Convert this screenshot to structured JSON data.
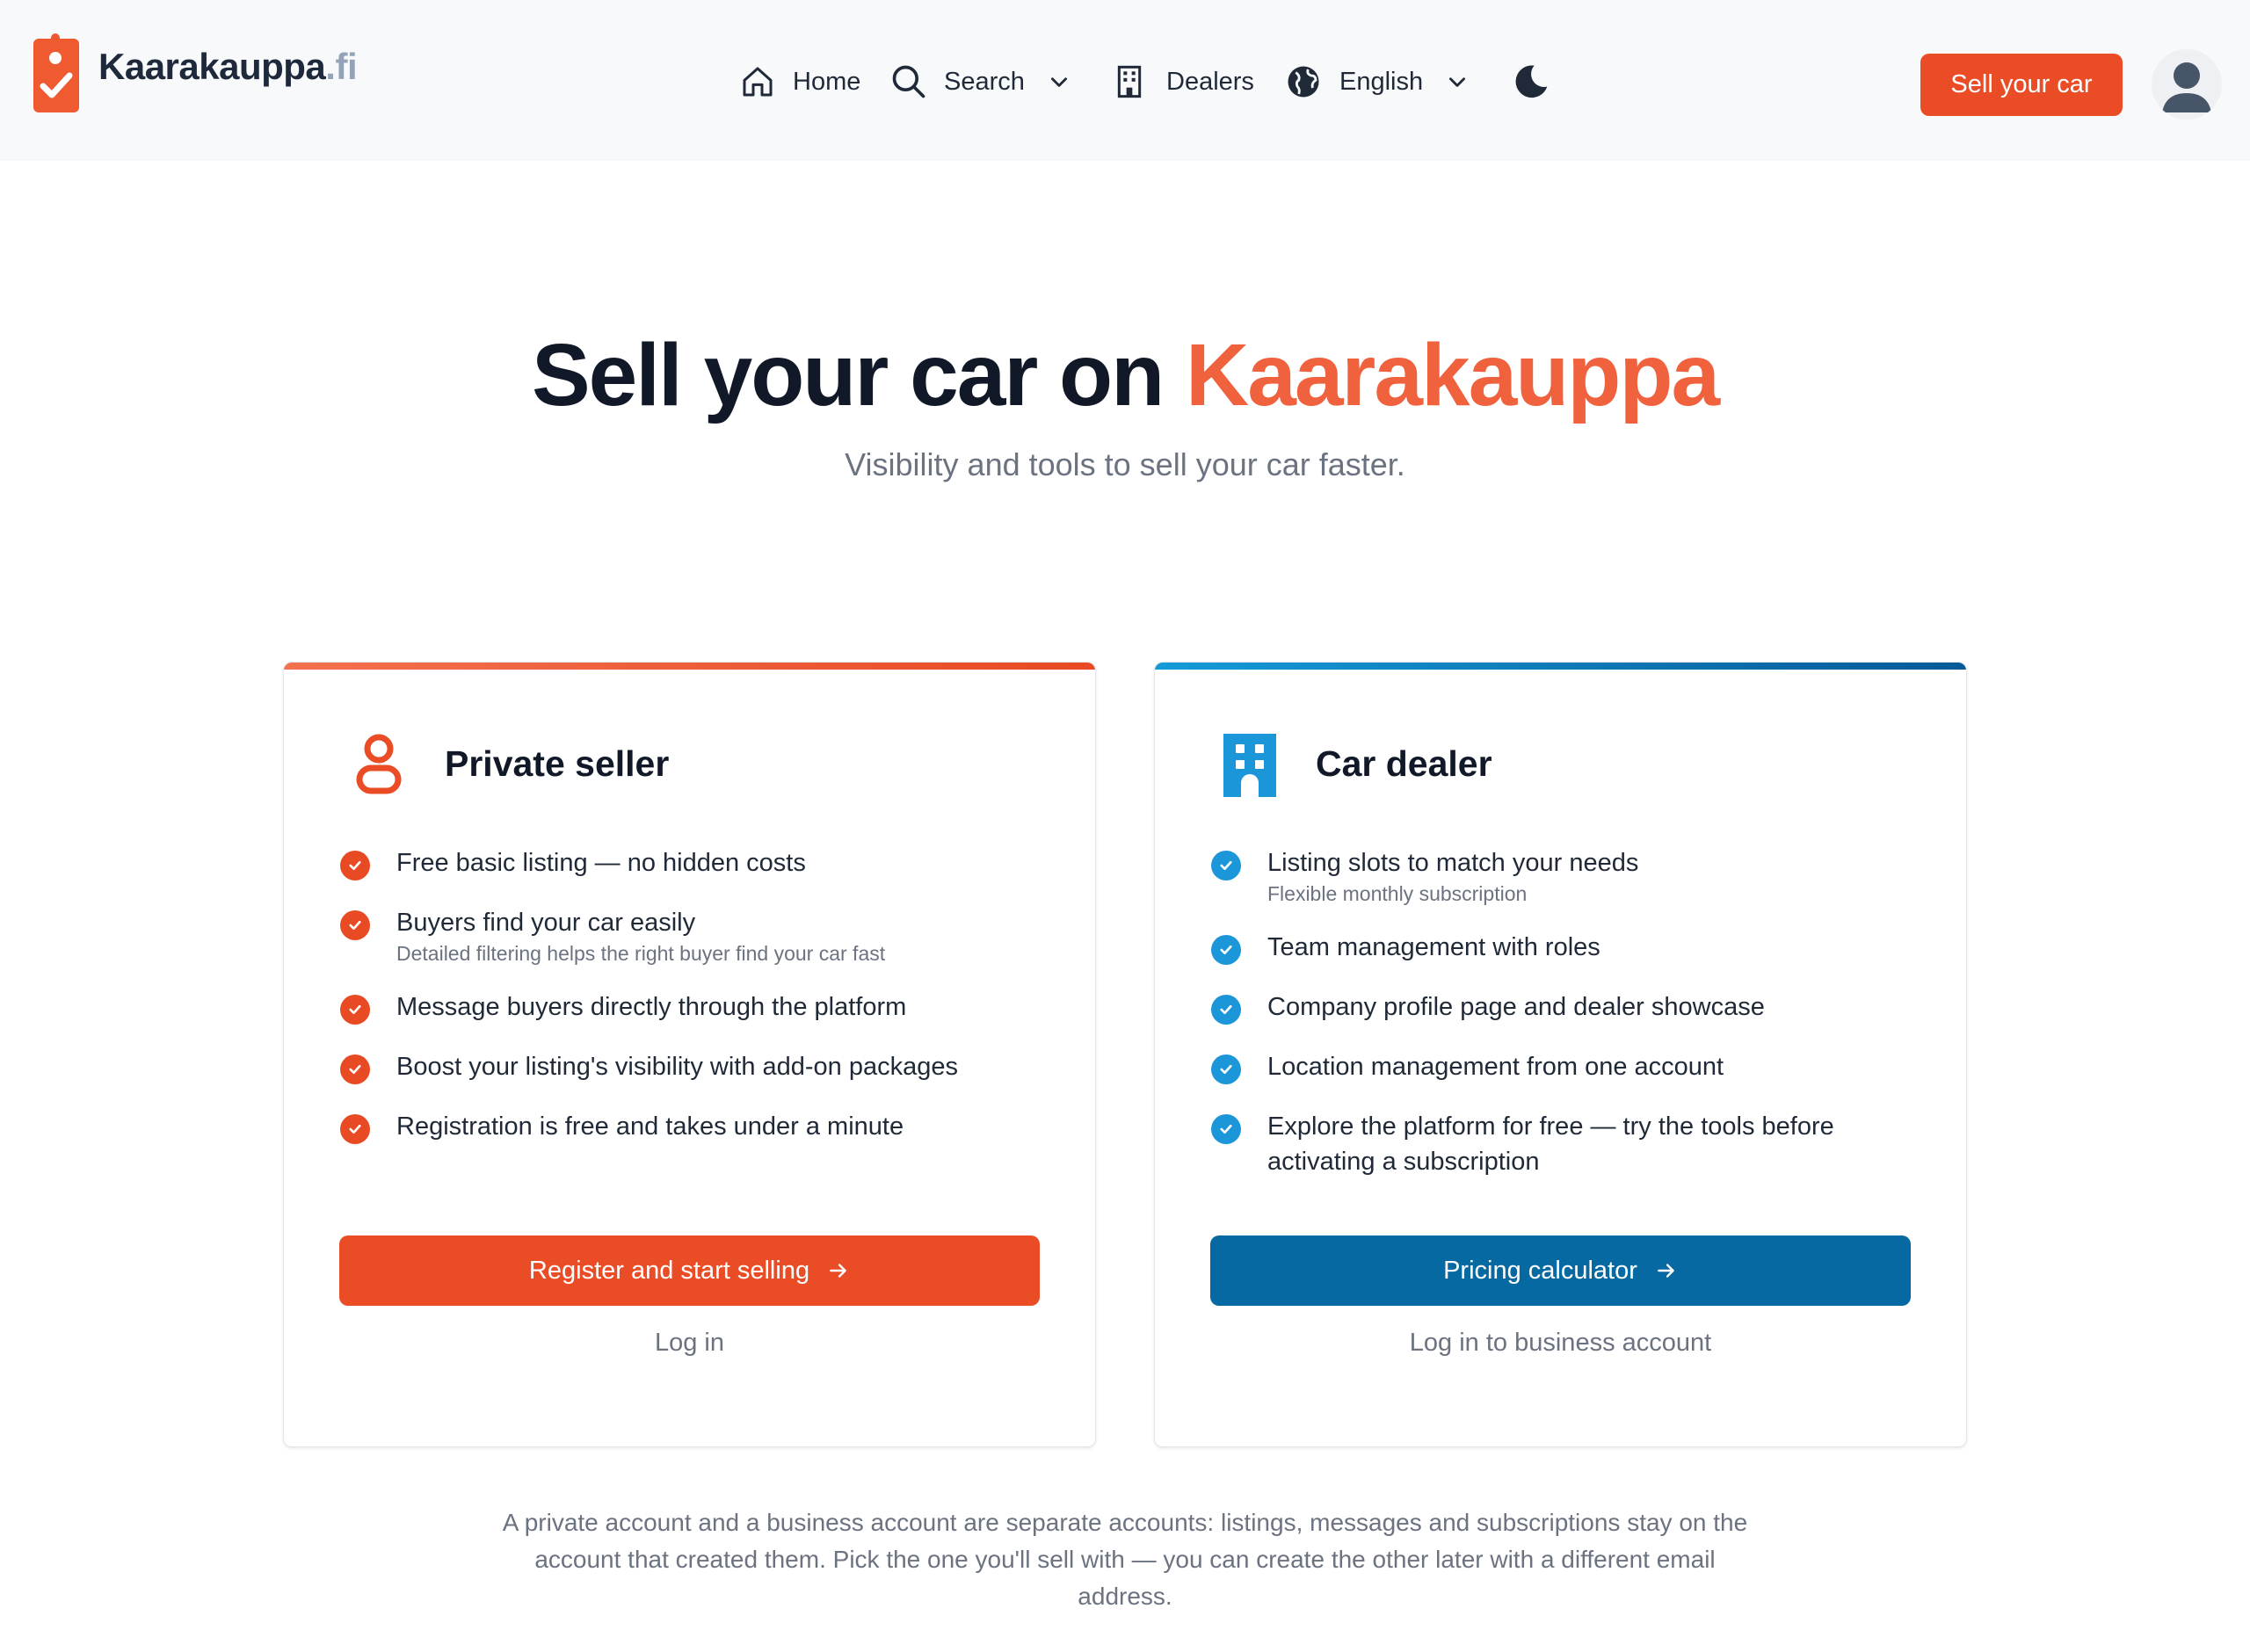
{
  "header": {
    "logo_name": "Kaarakauppa",
    "logo_tld": ".fi",
    "nav": {
      "home": "Home",
      "search": "Search",
      "dealers": "Dealers",
      "language": "English"
    },
    "sell_button": "Sell your car"
  },
  "hero": {
    "title_main": "Sell your car on",
    "title_accent": "Kaarakauppa",
    "subtitle": "Visibility and tools to sell your car faster."
  },
  "private": {
    "title": "Private seller",
    "features": [
      {
        "text": "Free basic listing — no hidden costs",
        "sub": ""
      },
      {
        "text": "Buyers find your car easily",
        "sub": "Detailed filtering helps the right buyer find your car fast"
      },
      {
        "text": "Message buyers directly through the platform",
        "sub": ""
      },
      {
        "text": "Boost your listing's visibility with add-on packages",
        "sub": ""
      },
      {
        "text": "Registration is free and takes under a minute",
        "sub": ""
      }
    ],
    "primary_button": "Register and start selling",
    "secondary_link": "Log in"
  },
  "dealer": {
    "title": "Car dealer",
    "features": [
      {
        "text": "Listing slots to match your needs",
        "sub": "Flexible monthly subscription"
      },
      {
        "text": "Team management with roles",
        "sub": ""
      },
      {
        "text": "Company profile page and dealer showcase",
        "sub": ""
      },
      {
        "text": "Location management from one account",
        "sub": ""
      },
      {
        "text": "Explore the platform for free — try the tools before",
        "text2": "activating a subscription"
      }
    ],
    "primary_button": "Pricing calculator",
    "secondary_link": "Log in to business account"
  },
  "footer_note": {
    "line1": "A private account and a business account are separate accounts: listings, messages and subscriptions stay on the",
    "line2": "account that created them. Pick the one you'll sell with — you can create the other later with a different email",
    "line3": "address."
  },
  "colors": {
    "accent_orange": "#ea4c26",
    "accent_blue": "#0669a1",
    "check_blue": "#1b97d9",
    "header_bg": "#f8f9fb"
  },
  "icons": [
    "logo-tag-icon",
    "home-icon",
    "search-icon",
    "chevron-down-icon",
    "building-icon",
    "globe-icon",
    "moon-icon",
    "user-avatar-icon",
    "person-icon",
    "check-icon",
    "arrow-right-icon"
  ]
}
